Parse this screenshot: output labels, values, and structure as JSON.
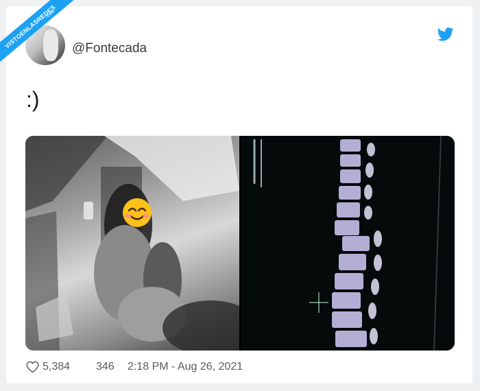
{
  "watermark": {
    "text": "VISTOENLASREDES",
    "suffix": ".com"
  },
  "tweet": {
    "handle": "@Fontecada",
    "text": ":)",
    "likes": "5,384",
    "retweets": "346",
    "timestamp": "2:18 PM - Aug 26, 2021"
  },
  "icons": {
    "logo": "twitter-bird-icon",
    "like": "heart-icon",
    "sticker": "smiling-face-emoji"
  },
  "colors": {
    "accent": "#1da1f2",
    "meta_text": "#5b5b5b"
  }
}
